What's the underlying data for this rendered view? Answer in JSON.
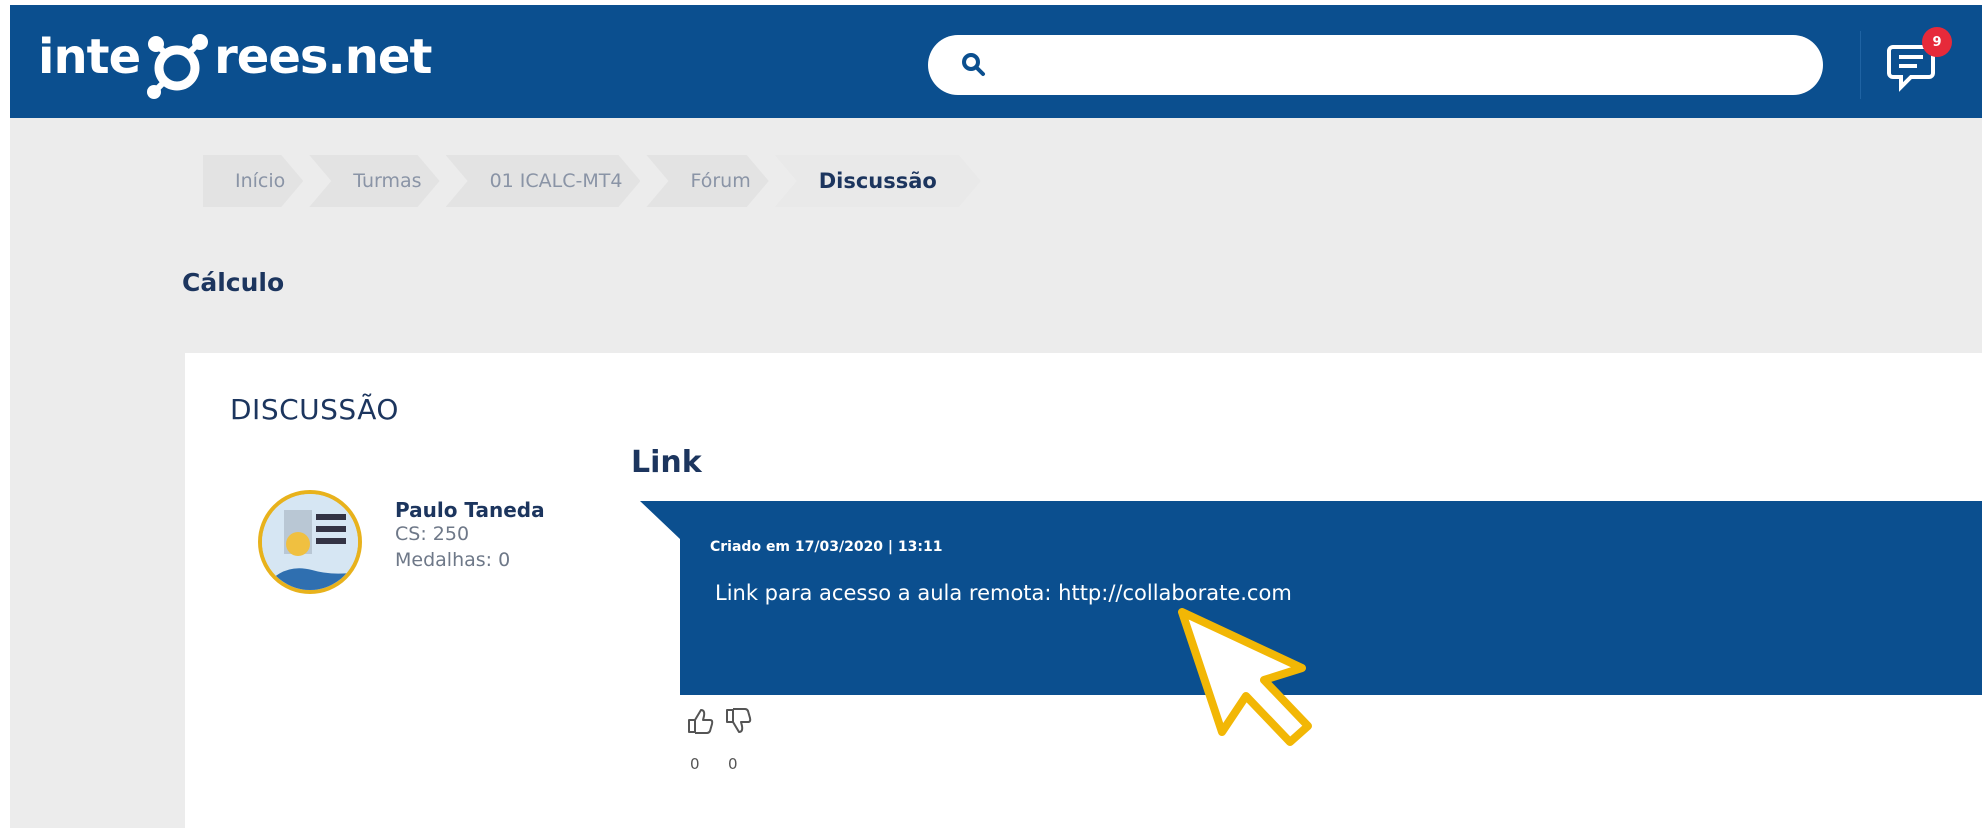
{
  "header": {
    "logo_text_left": "inte",
    "logo_text_right": "rees.net",
    "search_placeholder": "",
    "notification_count": "9"
  },
  "breadcrumb": [
    "Início",
    "Turmas",
    "01 ICALC-MT4",
    "Fórum",
    "Discussão"
  ],
  "page_title": "Cálculo",
  "section_label": "DISCUSSÃO",
  "author": {
    "name": "Paulo Taneda",
    "cs": "CS: 250",
    "medals": "Medalhas: 0"
  },
  "post": {
    "title": "Link",
    "meta": "Criado em 17/03/2020 | 13:11",
    "body": "Link para acesso a aula remota: http://collaborate.com",
    "likes": "0",
    "dislikes": "0"
  },
  "colors": {
    "brand_blue": "#0b4f8f",
    "title_navy": "#1c355e",
    "cursor_yellow": "#f2b705",
    "badge_red": "#e62a3a",
    "background": "#ececec"
  },
  "icons": [
    "molecule-logo-icon",
    "search-icon",
    "chat-icon",
    "thumbs-up-icon",
    "thumbs-down-icon",
    "cursor-arrow-icon"
  ]
}
